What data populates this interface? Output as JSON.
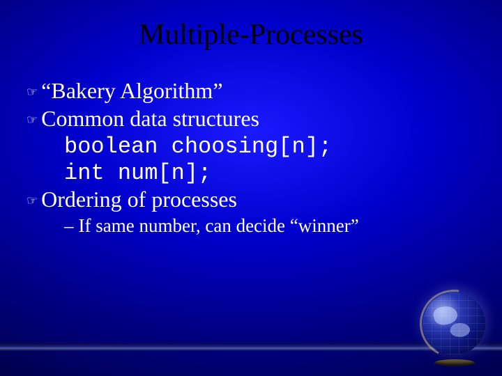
{
  "title": "Multiple-Processes",
  "bullets": [
    {
      "text": "“Bakery Algorithm”"
    },
    {
      "text": "Common data structures"
    }
  ],
  "code": [
    "boolean choosing[n];",
    "int num[n];"
  ],
  "bullet3": {
    "text": "Ordering of processes"
  },
  "sub1": {
    "dash": "–",
    "text": "If same number, can decide “winner”"
  },
  "icons": {
    "hand": "☞"
  }
}
